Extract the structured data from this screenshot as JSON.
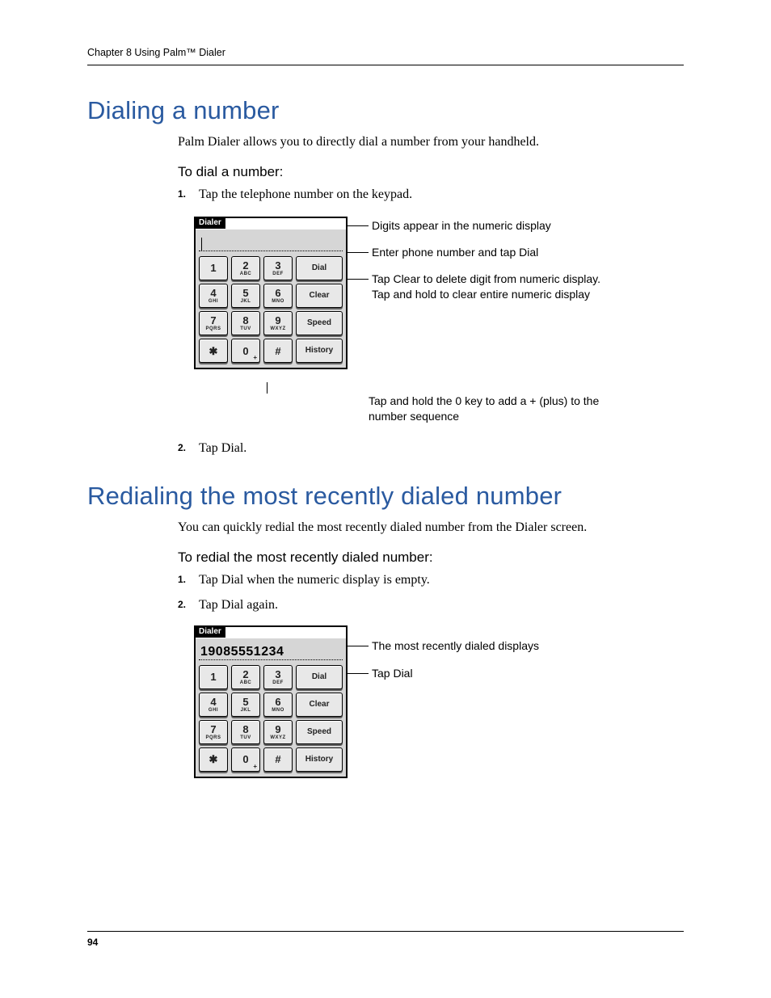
{
  "running_head": "Chapter 8   Using Palm™ Dialer",
  "page_number": "94",
  "section1": {
    "title": "Dialing a number",
    "intro": "Palm Dialer allows you to directly dial a number from your handheld.",
    "task_heading": "To dial a number:",
    "step1_num": "1.",
    "step1": "Tap the telephone number on the keypad.",
    "step2_num": "2.",
    "step2": "Tap Dial."
  },
  "section2": {
    "title": "Redialing the most recently dialed number",
    "intro": "You can quickly redial the most recently dialed number from the Dialer screen.",
    "task_heading": "To redial the most recently dialed number:",
    "step1_num": "1.",
    "step1": "Tap Dial when the numeric display is empty.",
    "step2_num": "2.",
    "step2": "Tap Dial again."
  },
  "dialer": {
    "tab": "Dialer",
    "display_empty": "",
    "display_recent": "19085551234",
    "keys": {
      "k1": {
        "d": "1",
        "s": ""
      },
      "k2": {
        "d": "2",
        "s": "ABC"
      },
      "k3": {
        "d": "3",
        "s": "DEF"
      },
      "k4": {
        "d": "4",
        "s": "GHI"
      },
      "k5": {
        "d": "5",
        "s": "JKL"
      },
      "k6": {
        "d": "6",
        "s": "MNO"
      },
      "k7": {
        "d": "7",
        "s": "PQRS"
      },
      "k8": {
        "d": "8",
        "s": "TUV"
      },
      "k9": {
        "d": "9",
        "s": "WXYZ"
      },
      "kstar": {
        "d": "✱",
        "s": ""
      },
      "k0": {
        "d": "0",
        "s": ""
      },
      "khash": {
        "d": "#",
        "s": ""
      }
    },
    "actions": {
      "dial": "Dial",
      "clear": "Clear",
      "speed": "Speed",
      "history": "History"
    }
  },
  "callouts1": {
    "c1": "Digits appear in the numeric display",
    "c2": "Enter phone number and tap Dial",
    "c3": "Tap Clear to delete digit from numeric display. Tap and hold to clear entire numeric display",
    "c4": "Tap and hold the 0 key to add a + (plus) to the number sequence"
  },
  "callouts2": {
    "c1": "The most recently dialed displays",
    "c2": "Tap Dial"
  }
}
